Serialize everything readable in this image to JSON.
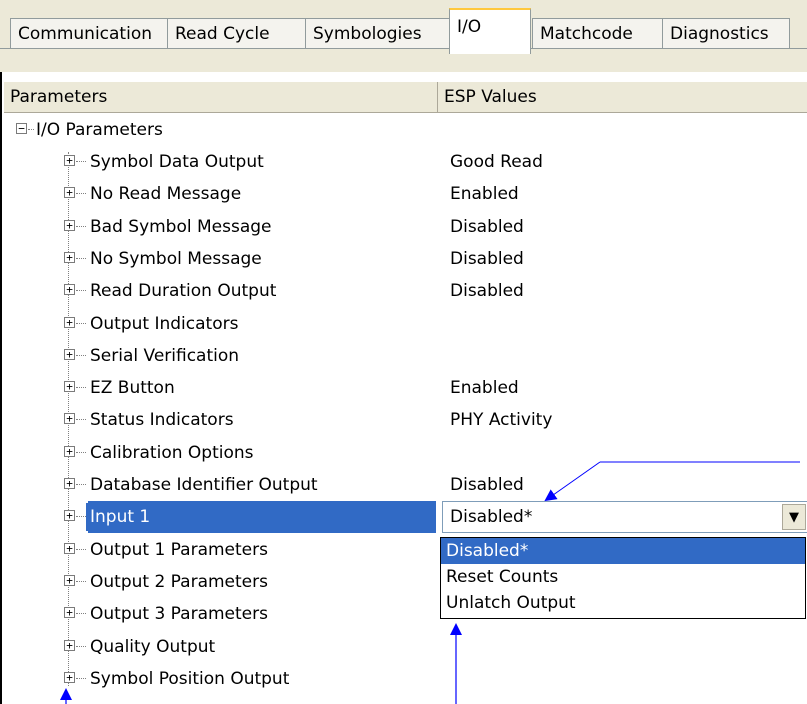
{
  "tabs": [
    "Communication",
    "Read Cycle",
    "Symbologies",
    "I/O",
    "Matchcode",
    "Diagnostics"
  ],
  "header": {
    "col1": "Parameters",
    "col2": "ESP Values"
  },
  "root": {
    "label": "I/O Parameters",
    "expand": "−"
  },
  "rows": [
    {
      "label": "Symbol Data Output",
      "value": "Good Read"
    },
    {
      "label": "No Read Message",
      "value": "Enabled"
    },
    {
      "label": "Bad Symbol Message",
      "value": "Disabled"
    },
    {
      "label": "No Symbol Message",
      "value": "Disabled"
    },
    {
      "label": "Read Duration Output",
      "value": "Disabled"
    },
    {
      "label": "Output Indicators",
      "value": ""
    },
    {
      "label": "Serial Verification",
      "value": ""
    },
    {
      "label": "EZ Button",
      "value": "Enabled"
    },
    {
      "label": "Status Indicators",
      "value": "PHY Activity"
    },
    {
      "label": "Calibration Options",
      "value": ""
    },
    {
      "label": "Database Identifier Output",
      "value": "Disabled"
    },
    {
      "label": "Input 1",
      "value": "Disabled*"
    },
    {
      "label": "Output 1 Parameters",
      "value": ""
    },
    {
      "label": "Output 2 Parameters",
      "value": ""
    },
    {
      "label": "Output 3 Parameters",
      "value": ""
    },
    {
      "label": "Quality Output",
      "value": ""
    },
    {
      "label": "Symbol Position Output",
      "value": ""
    }
  ],
  "expand_glyph": "+",
  "combo": {
    "value": "Disabled*",
    "arrow": "▼"
  },
  "dropdown_options": [
    "Disabled*",
    "Reset Counts",
    "Unlatch Output"
  ],
  "colors": {
    "selection": "#316ac5",
    "callout": "#0000ff",
    "tab_face": "#ece9d8"
  }
}
